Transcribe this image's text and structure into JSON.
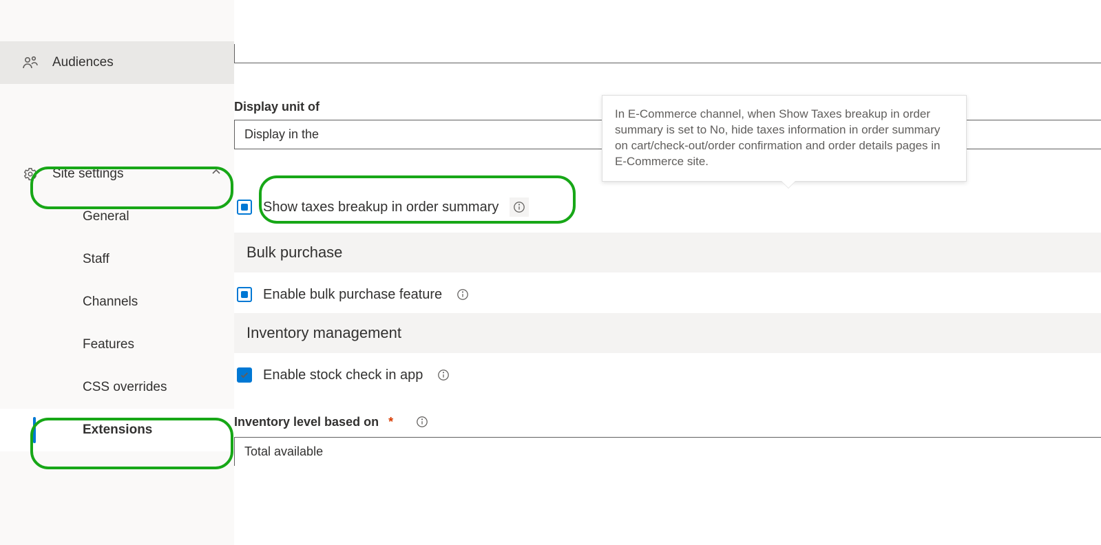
{
  "sidebar": {
    "audiences": "Audiences",
    "site_settings": "Site settings",
    "subs": {
      "general": "General",
      "staff": "Staff",
      "channels": "Channels",
      "features": "Features",
      "css": "CSS overrides",
      "extensions": "Extensions"
    }
  },
  "tooltip": "In E-Commerce channel, when Show Taxes breakup in order summary is set to No, hide taxes information in order summary on cart/check-out/order confirmation and order details pages in E-Commerce site.",
  "display_unit": {
    "label_partial": "Display unit of",
    "value_partial": "Display in the"
  },
  "taxes": {
    "label": "Show taxes breakup in order summary"
  },
  "bulk": {
    "header": "Bulk purchase",
    "label": "Enable bulk purchase feature"
  },
  "inventory": {
    "header": "Inventory management",
    "check_label": "Enable stock check in app",
    "level_label": "Inventory level based on",
    "level_value": "Total available"
  }
}
